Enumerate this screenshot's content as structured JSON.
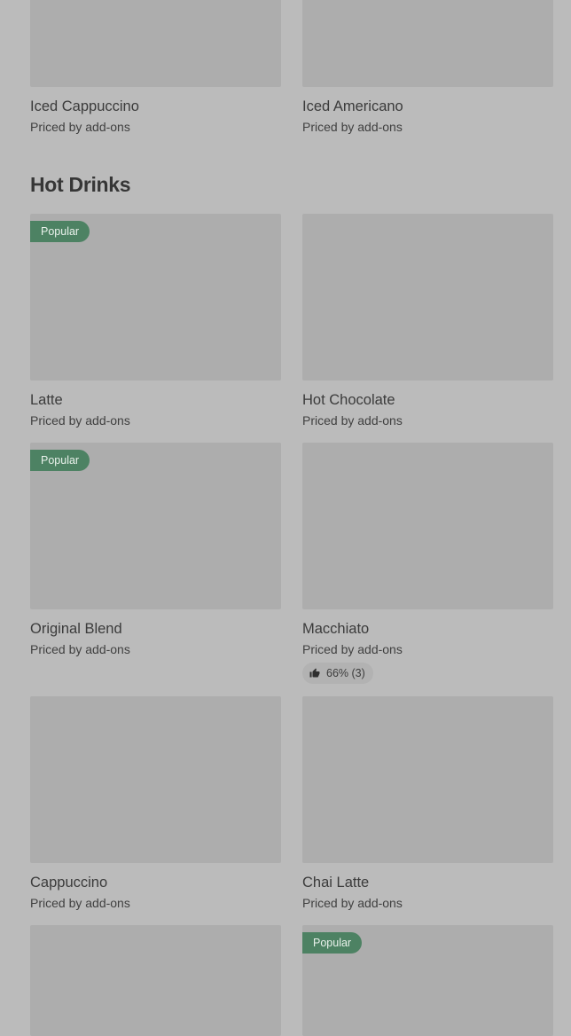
{
  "top_cards": [
    {
      "name": "Iced Cappuccino",
      "price": "Priced by add-ons"
    },
    {
      "name": "Iced Americano",
      "price": "Priced by add-ons"
    }
  ],
  "section": {
    "title": "Hot Drinks"
  },
  "popular_label": "Popular",
  "hot_drinks": [
    {
      "name": "Latte",
      "price": "Priced by add-ons",
      "popular": true
    },
    {
      "name": "Hot Chocolate",
      "price": "Priced by add-ons",
      "popular": false
    },
    {
      "name": "Original Blend",
      "price": "Priced by add-ons",
      "popular": true
    },
    {
      "name": "Macchiato",
      "price": "Priced by add-ons",
      "popular": false,
      "rating": "66% (3)",
      "rating_icon": "thumbs-up-icon"
    },
    {
      "name": "Cappuccino",
      "price": "Priced by add-ons",
      "popular": false
    },
    {
      "name": "Chai Latte",
      "price": "Priced by add-ons",
      "popular": false
    }
  ],
  "partial_cards": [
    {
      "popular": false
    },
    {
      "popular": true
    }
  ],
  "colors": {
    "background": "#bbbbbb",
    "thumbnail": "#adadad",
    "popular_badge": "#4d8263",
    "text": "#3a3a3a"
  }
}
